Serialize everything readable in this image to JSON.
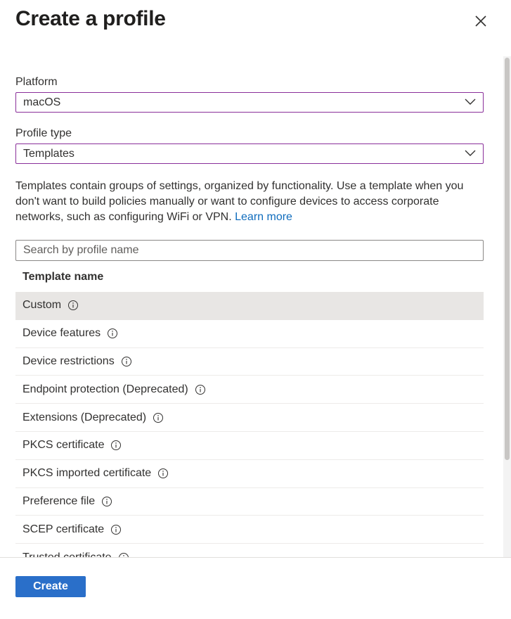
{
  "header": {
    "title": "Create a profile",
    "close_icon": "close-icon"
  },
  "platform": {
    "label": "Platform",
    "value": "macOS"
  },
  "profile_type": {
    "label": "Profile type",
    "value": "Templates"
  },
  "description": {
    "text": "Templates contain groups of settings, organized by functionality. Use a template when you don't want to build policies manually or want to configure devices to access corporate networks, such as configuring WiFi or VPN.",
    "link_text": "Learn more"
  },
  "search": {
    "placeholder": "Search by profile name",
    "value": ""
  },
  "table": {
    "column_header": "Template name",
    "rows": [
      {
        "name": "Custom",
        "selected": true
      },
      {
        "name": "Device features"
      },
      {
        "name": "Device restrictions"
      },
      {
        "name": "Endpoint protection (Deprecated)"
      },
      {
        "name": "Extensions (Deprecated)"
      },
      {
        "name": "PKCS certificate"
      },
      {
        "name": "PKCS imported certificate"
      },
      {
        "name": "Preference file"
      },
      {
        "name": "SCEP certificate"
      },
      {
        "name": "Trusted certificate"
      }
    ]
  },
  "footer": {
    "create_label": "Create"
  },
  "colors": {
    "accent": "#2a6fc9",
    "dropdown_border": "#8a2f9a",
    "link": "#0f6cbd",
    "selected_row": "#e8e6e4"
  }
}
